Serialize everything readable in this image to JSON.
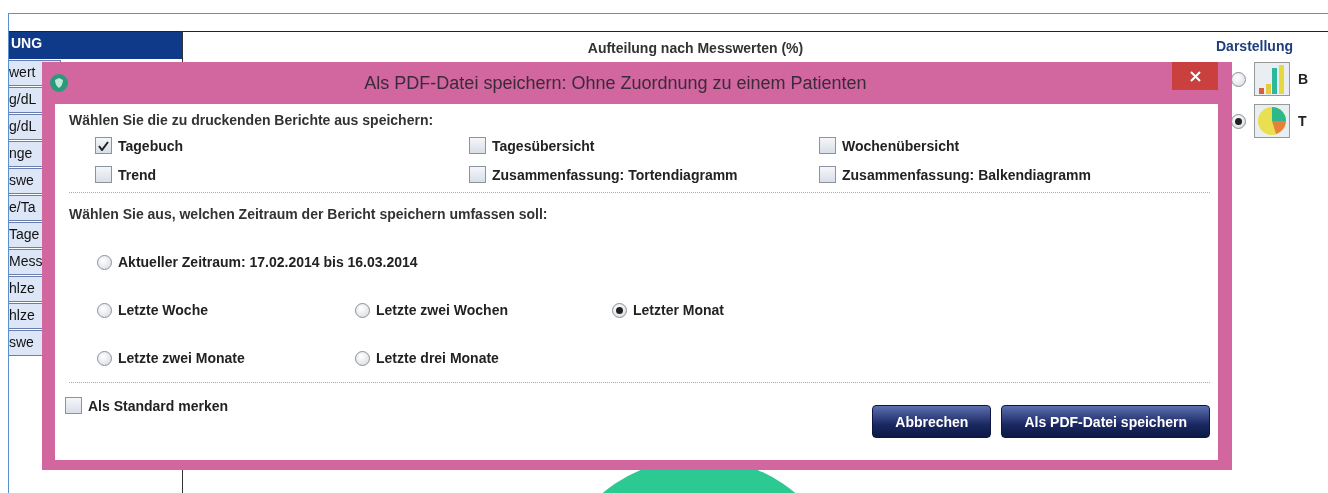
{
  "sidebar": {
    "header": "UNG",
    "items": [
      "wert",
      "g/dL",
      "g/dL",
      "nge",
      "swe",
      "e/Ta",
      "Tage",
      "Mess",
      "hlze",
      "hlze",
      "swe"
    ]
  },
  "chart_panel": {
    "title": "Aufteilung nach Messwerten (%)"
  },
  "display_panel": {
    "title": "Darstellung",
    "options": [
      {
        "kind": "bar",
        "label": "B",
        "selected": false
      },
      {
        "kind": "pie",
        "label": "T",
        "selected": true
      }
    ]
  },
  "dialog": {
    "title": "Als PDF-Datei speichern: Ohne Zuordnung zu einem Patienten",
    "reports_heading": "Wählen Sie die zu druckenden Berichte aus speichern:",
    "reports": [
      {
        "label": "Tagebuch",
        "checked": true
      },
      {
        "label": "Tagesübersicht",
        "checked": false
      },
      {
        "label": "Wochenübersicht",
        "checked": false
      },
      {
        "label": "Trend",
        "checked": false
      },
      {
        "label": "Zusammenfassung: Tortendiagramm",
        "checked": false
      },
      {
        "label": "Zusammenfassung: Balkendiagramm",
        "checked": false
      }
    ],
    "period_heading": "Wählen Sie aus, welchen Zeitraum der Bericht speichern umfassen soll:",
    "periods": [
      [
        {
          "label": "Aktueller Zeitraum: 17.02.2014  bis 16.03.2014",
          "selected": false
        }
      ],
      [
        {
          "label": "Letzte Woche",
          "selected": false
        },
        {
          "label": "Letzte zwei Wochen",
          "selected": false
        },
        {
          "label": "Letzter Monat",
          "selected": true
        }
      ],
      [
        {
          "label": "Letzte zwei Monate",
          "selected": false
        },
        {
          "label": "Letzte drei Monate",
          "selected": false
        }
      ]
    ],
    "remember": {
      "label": "Als Standard merken",
      "checked": false
    },
    "buttons": [
      "Abbrechen",
      "Als PDF-Datei speichern"
    ]
  }
}
